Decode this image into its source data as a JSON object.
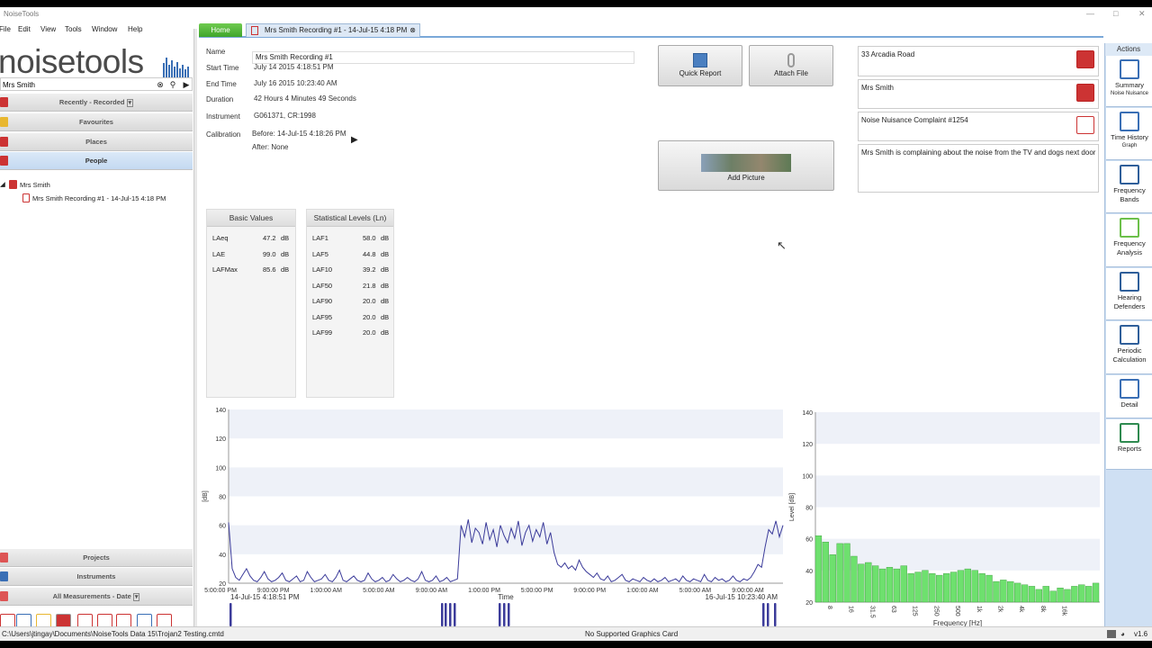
{
  "window": {
    "title": "NoiseTools",
    "version": "v1.6"
  },
  "menu": [
    "File",
    "Edit",
    "View",
    "Tools",
    "Window",
    "Help"
  ],
  "logo": {
    "text": "noisetools"
  },
  "search": {
    "value": "Mrs Smith"
  },
  "nav": {
    "recently": "Recently - Recorded",
    "favourites": "Favourites",
    "places": "Places",
    "people": "People",
    "projects": "Projects",
    "instruments": "Instruments",
    "all": "All Measurements - Date"
  },
  "tree": {
    "person": "Mrs Smith",
    "recording": "Mrs Smith Recording #1 - 14-Jul-15 4:18 PM"
  },
  "tabs": {
    "home": "Home",
    "recording": "Mrs Smith Recording #1 - 14-Jul-15 4:18 PM"
  },
  "details": {
    "name_label": "Name",
    "name": "Mrs Smith Recording #1",
    "start_label": "Start Time",
    "start": "July 14 2015 4:18:51 PM",
    "end_label": "End Time",
    "end": "July 16 2015 10:23:40 AM",
    "duration_label": "Duration",
    "duration": "42 Hours 4 Minutes 49 Seconds",
    "instrument_label": "Instrument",
    "instrument": "G061371, CR:1998",
    "calibration_label": "Calibration",
    "cal_before": "Before: 14-Jul-15 4:18:26 PM",
    "cal_after": "After: None"
  },
  "buttons": {
    "quick_report": "Quick Report",
    "attach_file": "Attach File",
    "add_picture": "Add Picture"
  },
  "right": {
    "address": "33 Arcadia Road",
    "person": "Mrs Smith",
    "complaint": "Noise Nuisance Complaint #1254",
    "notes": "Mrs Smith is complaining about the noise from the TV and dogs next door"
  },
  "basic": {
    "title": "Basic Values",
    "rows": [
      {
        "k": "LAeq",
        "v": "47.2",
        "u": "dB"
      },
      {
        "k": "LAE",
        "v": "99.0",
        "u": "dB"
      },
      {
        "k": "LAFMax",
        "v": "85.6",
        "u": "dB"
      }
    ]
  },
  "stat": {
    "title": "Statistical Levels (Ln)",
    "rows": [
      {
        "k": "LAF1",
        "v": "58.0",
        "u": "dB"
      },
      {
        "k": "LAF5",
        "v": "44.8",
        "u": "dB"
      },
      {
        "k": "LAF10",
        "v": "39.2",
        "u": "dB"
      },
      {
        "k": "LAF50",
        "v": "21.8",
        "u": "dB"
      },
      {
        "k": "LAF90",
        "v": "20.0",
        "u": "dB"
      },
      {
        "k": "LAF95",
        "v": "20.0",
        "u": "dB"
      },
      {
        "k": "LAF99",
        "v": "20.0",
        "u": "dB"
      }
    ]
  },
  "actions": {
    "title": "Actions",
    "items": [
      {
        "label": "Summary",
        "sub": "Noise Nuisance",
        "icon": "summary-icon"
      },
      {
        "label": "Time History",
        "sub": "Graph",
        "icon": "time-history-icon"
      },
      {
        "label": "Frequency Bands",
        "sub": "",
        "icon": "frequency-bands-icon"
      },
      {
        "label": "Frequency Analysis",
        "sub": "",
        "icon": "frequency-analysis-icon"
      },
      {
        "label": "Hearing Defenders",
        "sub": "",
        "icon": "hearing-defenders-icon"
      },
      {
        "label": "Periodic Calculation",
        "sub": "",
        "icon": "sigma-icon"
      },
      {
        "label": "Detail",
        "sub": "",
        "icon": "detail-icon"
      },
      {
        "label": "Reports",
        "sub": "",
        "icon": "reports-icon"
      }
    ]
  },
  "status": {
    "path": "C:\\Users\\jtingay\\Documents\\NoiseTools Data 15\\Trojan2 Testing.cmtd",
    "graphics": "No Supported Graphics Card",
    "version": "v1.6"
  },
  "chart_data": [
    {
      "type": "line",
      "ylabel": "[dB]",
      "xlabel": "Time",
      "ylim": [
        20,
        140
      ],
      "yticks": [
        20,
        40,
        60,
        80,
        100,
        120,
        140
      ],
      "xticks": [
        "5:00:00 PM",
        "9:00:00 PM",
        "1:00:00 AM",
        "5:00:00 AM",
        "9:00:00 AM",
        "1:00:00 PM",
        "5:00:00 PM",
        "9:00:00 PM",
        "1:00:00 AM",
        "5:00:00 AM",
        "9:00:00 AM"
      ],
      "start_label": "14-Jul-15 4:18:51 PM",
      "end_label": "16-Jul-15 10:23:40 AM",
      "color": "#3b3b9a",
      "series": [
        {
          "values": [
            62,
            30,
            24,
            22,
            26,
            30,
            25,
            22,
            21,
            24,
            28,
            23,
            21,
            22,
            24,
            27,
            22,
            21,
            23,
            25,
            21,
            22,
            28,
            24,
            21,
            22,
            23,
            26,
            22,
            21,
            24,
            29,
            22,
            21,
            23,
            25,
            22,
            21,
            22,
            27,
            23,
            21,
            22,
            24,
            21,
            22,
            26,
            23,
            21,
            22,
            24,
            22,
            21,
            23,
            28,
            22,
            21,
            22,
            25,
            21,
            22,
            24,
            21,
            22,
            23,
            60,
            52,
            64,
            48,
            58,
            55,
            47,
            62,
            50,
            57,
            45,
            60,
            53,
            48,
            58,
            51,
            63,
            46,
            55,
            60,
            49,
            57,
            52,
            62,
            47,
            55,
            41,
            33,
            31,
            34,
            30,
            32,
            29,
            36,
            31,
            28,
            26,
            24,
            27,
            23,
            22,
            25,
            21,
            22,
            24,
            26,
            22,
            21,
            23,
            22,
            21,
            24,
            22,
            21,
            23,
            21,
            22,
            24,
            21,
            22,
            23,
            21,
            25,
            22,
            21,
            23,
            22,
            21,
            26,
            22,
            21,
            24,
            22,
            23,
            21,
            22,
            25,
            22,
            21,
            23,
            22,
            24,
            28,
            33,
            31,
            45,
            57,
            54,
            63,
            52,
            60
          ]
        }
      ]
    },
    {
      "type": "bar",
      "ylabel": "Level [dB]",
      "xlabel": "Frequency [Hz]",
      "ylim": [
        20,
        140
      ],
      "yticks": [
        20,
        40,
        60,
        80,
        100,
        120,
        140
      ],
      "categories": [
        "8",
        "16",
        "31.5",
        "63",
        "125",
        "250",
        "500",
        "1k",
        "2k",
        "4k",
        "8k",
        "16k"
      ],
      "color": "#6ee06e",
      "values": [
        62,
        58,
        50,
        57,
        57,
        49,
        44,
        45,
        43,
        41,
        42,
        41,
        43,
        38,
        39,
        40,
        38,
        37,
        38,
        39,
        40,
        41,
        40,
        38,
        37,
        33,
        34,
        33,
        32,
        31,
        30,
        28,
        30,
        27,
        29,
        28,
        30,
        31,
        30,
        32
      ]
    }
  ]
}
